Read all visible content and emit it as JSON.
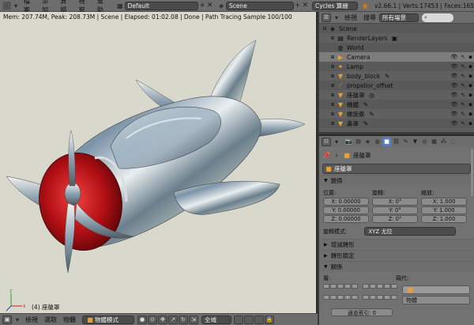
{
  "menubar": {
    "items": [
      "檔案",
      "添加",
      "算繪",
      "視窗",
      "幫助"
    ],
    "screen_layout": "Default",
    "scene": "Scene",
    "render_engine": "Cycles 算繪",
    "stats": "v2.66.1 | Verts:17453 | Faces:165"
  },
  "viewport": {
    "render_status": "Mem: 207.74M, Peak: 208.73M | Scene | Elapsed: 01:02.08 | Done | Path Tracing Sample 100/100",
    "object_label": "(4) 座艙罩"
  },
  "bottombar": {
    "items": [
      "檢視",
      "選取",
      "物體"
    ],
    "mode": "物體模式",
    "orientation": "全域"
  },
  "outliner": {
    "view_label": "檢視",
    "search_label": "搜尋",
    "display_mode": "所有場景",
    "rows": [
      {
        "label": "Scene",
        "indent": 0,
        "icon": "scene-icon",
        "expanded": true
      },
      {
        "label": "RenderLayers",
        "indent": 1,
        "icon": "renderlayers-icon",
        "expanded": false
      },
      {
        "label": "World",
        "indent": 1,
        "icon": "world-icon",
        "expanded": false
      },
      {
        "label": "Camera",
        "indent": 1,
        "icon": "camera-icon",
        "expanded": false
      },
      {
        "label": "Lamp",
        "indent": 1,
        "icon": "lamp-icon",
        "expanded": false
      },
      {
        "label": "body_block",
        "indent": 1,
        "icon": "mesh-icon",
        "expanded": false
      },
      {
        "label": "propellor_offset",
        "indent": 1,
        "icon": "empty-icon",
        "expanded": false
      },
      {
        "label": "座艙罩",
        "indent": 1,
        "icon": "mesh-icon",
        "expanded": false
      },
      {
        "label": "機體",
        "indent": 1,
        "icon": "mesh-icon",
        "expanded": false
      },
      {
        "label": "螺旋槳",
        "indent": 1,
        "icon": "mesh-icon",
        "expanded": false
      },
      {
        "label": "鼻罩",
        "indent": 1,
        "icon": "mesh-icon",
        "expanded": false
      }
    ]
  },
  "properties": {
    "breadcrumb": "座艙罩",
    "object_name": "座艙罩",
    "transform_panel": "變換",
    "location_label": "位置:",
    "rotation_label": "旋轉:",
    "scale_label": "縮放:",
    "location": [
      "X: 0.00000",
      "Y: 0.00000",
      "Z: 0.00000"
    ],
    "rotation": [
      "X: 0°",
      "Y: 0°",
      "Z: 0°"
    ],
    "scale": [
      "X: 1.000",
      "Y: 1.000",
      "Z: 1.000"
    ],
    "rotation_mode_label": "旋轉模式:",
    "rotation_mode": "XYZ 尤拉",
    "delta_panel": "增減轉形",
    "locks_panel": "轉形鎖定",
    "relations_panel": "關係",
    "layers_label": "層:",
    "parent_label": "親代:",
    "parent_type": "物體",
    "pass_index": "通道索引: 0"
  },
  "colors": {
    "accent": "#5680c2",
    "viewport_bg": "#d8d8cc",
    "header": "#6d6d6d"
  }
}
